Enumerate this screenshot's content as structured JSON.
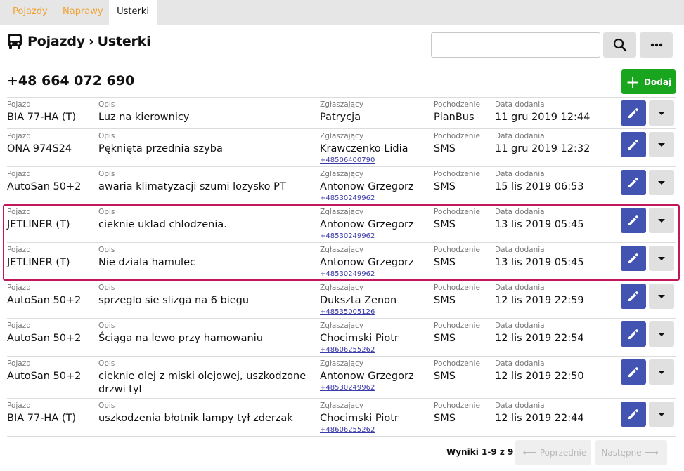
{
  "tabs": [
    {
      "label": "Pojazdy"
    },
    {
      "label": "Naprawy"
    },
    {
      "label": "Usterki"
    }
  ],
  "breadcrumb": {
    "parent": "Pojazdy",
    "separator": "›",
    "current": "Usterki"
  },
  "search": {
    "value": ""
  },
  "phone": "+48 664 072 690",
  "add_button": {
    "label": "Dodaj"
  },
  "labels": {
    "vehicle": "Pojazd",
    "description": "Opis",
    "reporter": "Zgłaszający",
    "source": "Pochodzenie",
    "date": "Data dodania"
  },
  "rows": [
    {
      "vehicle": "BIA 77-HA (T)",
      "description": "Luz na kierownicy",
      "reporter": "Patrycja",
      "phone": "",
      "source": "PlanBus",
      "date": "11 gru 2019 12:44"
    },
    {
      "vehicle": "ONA 974S24",
      "description": "Pęknięta przednia szyba",
      "reporter": "Krawczenko Lidia",
      "phone": "+48506400790",
      "source": "SMS",
      "date": "11 gru 2019 12:32"
    },
    {
      "vehicle": "AutoSan 50+2",
      "description": "awaria klimatyzacji szumi lozysko PT",
      "reporter": "Antonow Grzegorz",
      "phone": "+48530249962",
      "source": "SMS",
      "date": "15 lis 2019 06:53"
    },
    {
      "vehicle": "JETLINER (T)",
      "description": "cieknie uklad chlodzenia.",
      "reporter": "Antonow Grzegorz",
      "phone": "+48530249962",
      "source": "SMS",
      "date": "13 lis 2019 05:45"
    },
    {
      "vehicle": "JETLINER (T)",
      "description": "Nie dziala hamulec",
      "reporter": "Antonow Grzegorz",
      "phone": "+48530249962",
      "source": "SMS",
      "date": "13 lis 2019 05:45"
    },
    {
      "vehicle": "AutoSan 50+2",
      "description": "sprzeglo sie slizga na 6 biegu",
      "reporter": "Dukszta Zenon",
      "phone": "+48535005126",
      "source": "SMS",
      "date": "12 lis 2019 22:59"
    },
    {
      "vehicle": "AutoSan 50+2",
      "description": "Ściąga na lewo przy hamowaniu",
      "reporter": "Chocimski Piotr",
      "phone": "+48606255262",
      "source": "SMS",
      "date": "12 lis 2019 22:54"
    },
    {
      "vehicle": "AutoSan 50+2",
      "description": "cieknie olej z miski olejowej, uszkodzone drzwi tyl",
      "reporter": "Antonow Grzegorz",
      "phone": "+48530249962",
      "source": "SMS",
      "date": "12 lis 2019 22:50"
    },
    {
      "vehicle": "BIA 77-HA (T)",
      "description": "uszkodzenia błotnik lampy tył zderzak",
      "reporter": "Chocimski Piotr",
      "phone": "+48606255262",
      "source": "SMS",
      "date": "12 lis 2019 22:44"
    }
  ],
  "pagination": {
    "results": "Wyniki 1-9 z 9",
    "prev": "Poprzednie",
    "next": "Następne"
  },
  "colors": {
    "tab_inactive": "#f0a030",
    "add_button": "#1aa51f",
    "edit_button": "#4253b2",
    "highlight_border": "#c2185b"
  }
}
